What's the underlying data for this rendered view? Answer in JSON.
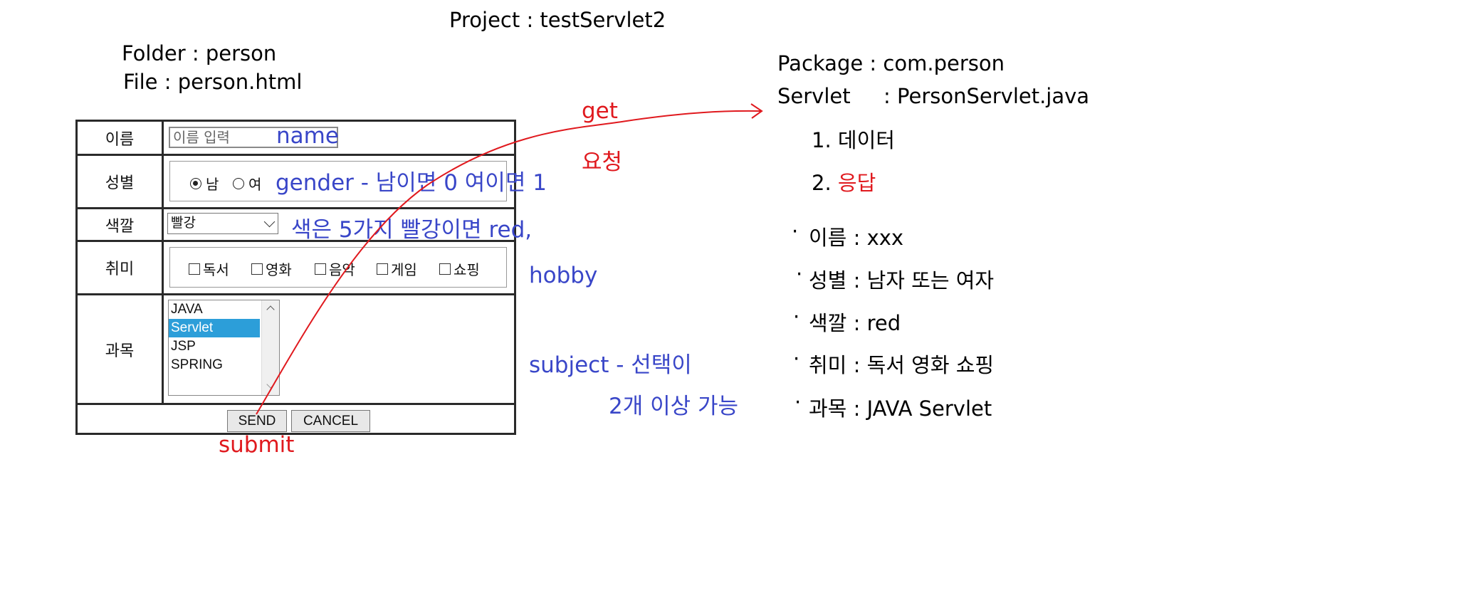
{
  "header": {
    "project": "Project : testServlet2",
    "folder": "Folder : person",
    "file": "File : person.html"
  },
  "form": {
    "name_label": "이름",
    "name_placeholder": "이름 입력",
    "gender_label": "성별",
    "gender_options": [
      "남",
      "여"
    ],
    "gender_selected": "남",
    "color_label": "색깔",
    "color_selected": "빨강",
    "hobby_label": "취미",
    "hobbies": [
      "독서",
      "영화",
      "음악",
      "게임",
      "쇼핑"
    ],
    "subject_label": "과목",
    "subjects": [
      "JAVA",
      "Servlet",
      "JSP",
      "SPRING"
    ],
    "subject_selected": "Servlet",
    "send_label": "SEND",
    "cancel_label": "CANCEL"
  },
  "annotations": {
    "name": "name",
    "gender": "gender  -  남이면 0  여이면 1",
    "color": "색은 5가지   빨강이면 red,",
    "hobby": "hobby",
    "subject_1": "subject - 선택이",
    "subject_2": "2개  이상  가능",
    "submit": "submit",
    "get": "get",
    "request": "요청"
  },
  "servlet": {
    "package": "Package : com.person",
    "servlet_prefix": "Servlet",
    "servlet_value": ": PersonServlet.java",
    "step1": "1. 데이터",
    "step2_num": "2.",
    "step2_text": "응답",
    "results": [
      "이름 : xxx",
      "성별 : 남자 또는 여자",
      "색깔 : red",
      "취미 : 독서 영화 쇼핑",
      "과목 : JAVA Servlet"
    ]
  },
  "colors": {
    "annotation_blue": "#3946c8",
    "annotation_red": "#e0191e",
    "selected_option": "#2c9ed9"
  }
}
